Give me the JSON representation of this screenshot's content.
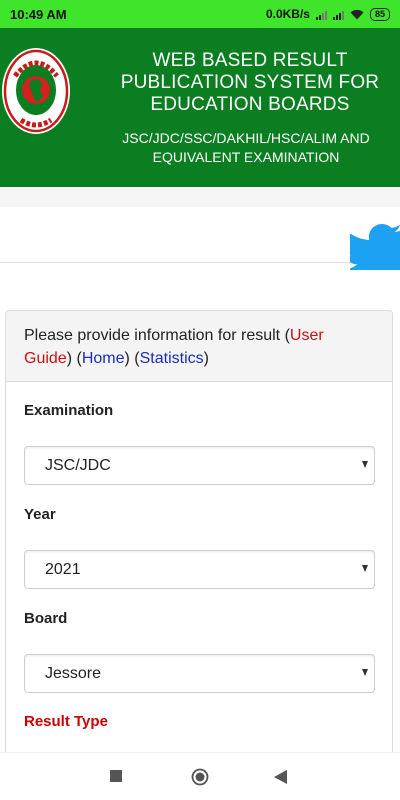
{
  "status_bar": {
    "time": "10:49 AM",
    "network_speed": "0.0KB/s",
    "battery": "85",
    "icons": [
      "signal-icon",
      "signal-icon",
      "wifi-icon",
      "battery-icon"
    ]
  },
  "header": {
    "title": "WEB BASED RESULT PUBLICATION SYSTEM FOR EDUCATION BOARDS",
    "subtitle": "JSC/JDC/SSC/DAKHIL/HSC/ALIM AND EQUIVALENT EXAMINATION",
    "logo": "bangladesh-government-seal",
    "logo_text": "গণপ্রজাতন্ত্রী বাংলাদেশ সরকার",
    "colors": {
      "header_bg": "#0a7e20",
      "status_bg": "#3ee52b"
    }
  },
  "social": {
    "icon": "twitter-icon",
    "color": "#1da1f2"
  },
  "form": {
    "intro_text": "Please provide information for result (",
    "user_guide": "User Guide",
    "sep1": ") (",
    "home": "Home",
    "sep2": ") (",
    "statistics": "Statistics",
    "intro_end": ")",
    "examination_label": "Examination",
    "examination_value": "JSC/JDC",
    "year_label": "Year",
    "year_value": "2021",
    "board_label": "Board",
    "board_value": "Jessore",
    "result_type_label": "Result Type"
  },
  "nav": {
    "icons": [
      "recents-icon",
      "home-icon",
      "back-icon"
    ]
  }
}
